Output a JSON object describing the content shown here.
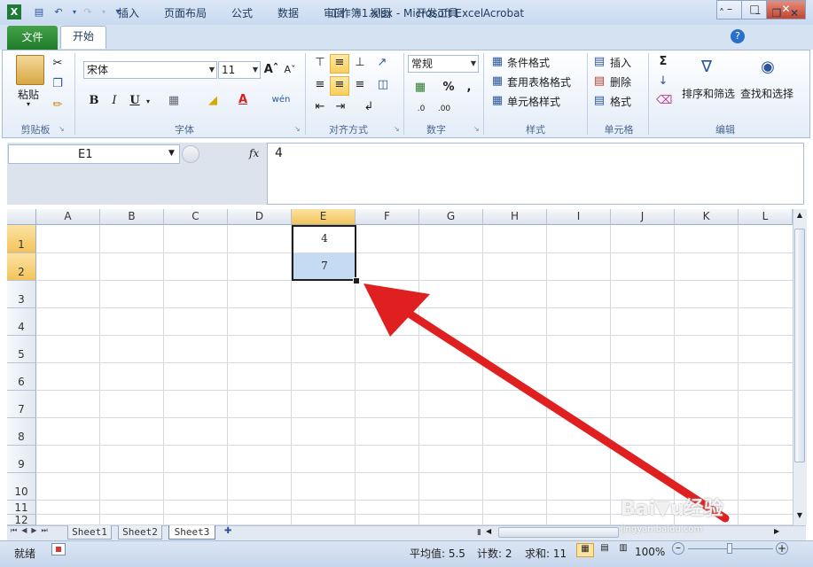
{
  "window": {
    "title": "工作簿1.xlsx - Microsoft Excel",
    "minimize_icon": "minimize-icon",
    "maximize_icon": "maximize-icon",
    "close_icon": "close-icon"
  },
  "tabs": [
    "文件",
    "开始",
    "插入",
    "页面布局",
    "公式",
    "数据",
    "审阅",
    "视图",
    "开发工具",
    "Acrobat"
  ],
  "ribbon": {
    "clipboard": {
      "paste": "粘贴",
      "label": "剪贴板"
    },
    "font": {
      "name": "宋体",
      "size": "11",
      "bold": "B",
      "italic": "I",
      "underline": "U",
      "label": "字体"
    },
    "alignment": {
      "label": "对齐方式"
    },
    "number": {
      "format": "常规",
      "label": "数字"
    },
    "styles": {
      "conditional": "条件格式",
      "table": "套用表格格式",
      "cell": "单元格样式",
      "label": "样式"
    },
    "cells": {
      "insert": "插入",
      "delete": "删除",
      "format": "格式",
      "label": "单元格"
    },
    "editing": {
      "sort": "排序和筛选",
      "find": "查找和选择",
      "label": "编辑"
    }
  },
  "formula_bar": {
    "name_box": "E1",
    "fx": "fx",
    "value": "4"
  },
  "columns": [
    "A",
    "B",
    "C",
    "D",
    "E",
    "F",
    "G",
    "H",
    "I",
    "J",
    "K",
    "L"
  ],
  "rows": [
    "1",
    "2",
    "3",
    "4",
    "5",
    "6",
    "7",
    "8",
    "9",
    "10",
    "11",
    "12"
  ],
  "cells": {
    "E1": "4",
    "E2": "7"
  },
  "sheets": [
    "Sheet1",
    "Sheet2",
    "Sheet3"
  ],
  "active_sheet": "Sheet3",
  "status": {
    "ready": "就绪",
    "average": "平均值: 5.5",
    "count": "计数: 2",
    "sum": "求和: 11",
    "zoom": "100%"
  },
  "watermark": "Baidu经验 jingyan.baidu.com"
}
